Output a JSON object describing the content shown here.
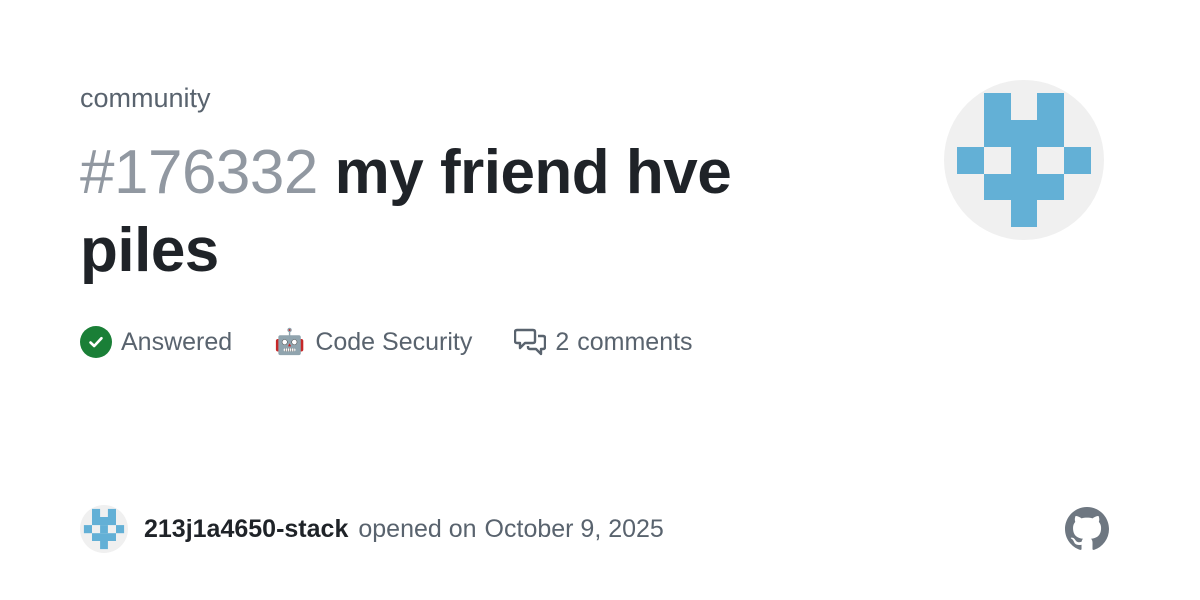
{
  "repository": {
    "name": "community"
  },
  "discussion": {
    "number": "#176332",
    "title": "my friend hve piles"
  },
  "meta": {
    "status": "Answered",
    "category_emoji": "🤖",
    "category": "Code Security",
    "comments_count": "2",
    "comments_label": "comments"
  },
  "footer": {
    "author": "213j1a4650-stack",
    "opened_text": "opened on",
    "date": "October 9, 2025"
  },
  "colors": {
    "avatar_blue": "#63b0d6",
    "avatar_bg": "#f0f0f0",
    "answered_green": "#1a7f37",
    "muted_text": "#59636e",
    "github_logo": "#6e7781"
  },
  "icons": {
    "status": "check-circle-icon",
    "comments": "comment-discussion-icon",
    "brand": "github-mark-icon"
  }
}
